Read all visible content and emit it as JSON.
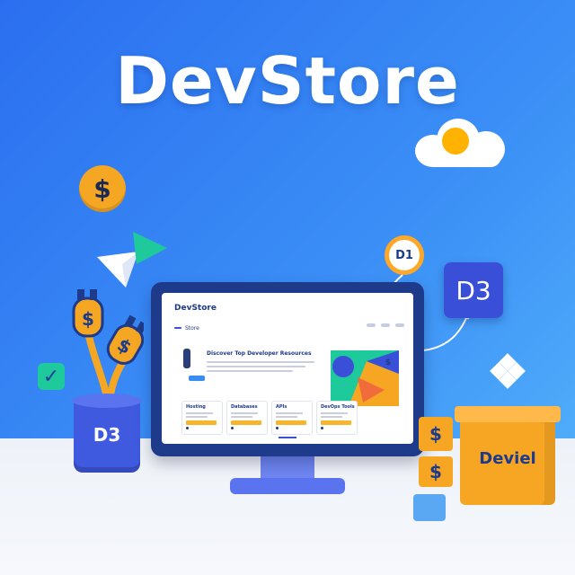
{
  "title": "DevStore",
  "icons": {
    "coin_symbol": "$",
    "check_symbol": "✓",
    "ring_label": "D1",
    "badge_label": "D3",
    "bucket_label": "D3"
  },
  "screen": {
    "brand": "DevStore",
    "nav_pill": "",
    "nav_tab": "Store",
    "hero_heading": "Discover Top Developer Resources",
    "cards": [
      {
        "title": "Hosting"
      },
      {
        "title": "Databases"
      },
      {
        "title": "APIs"
      },
      {
        "title": "DevOps Tools"
      }
    ]
  },
  "boxes": {
    "small_symbol": "$",
    "big_label": "Deviel"
  },
  "colors": {
    "bg_start": "#2b6ff0",
    "bg_end": "#56b6fb",
    "accent": "#f7a623",
    "navy": "#1e3a8a"
  }
}
